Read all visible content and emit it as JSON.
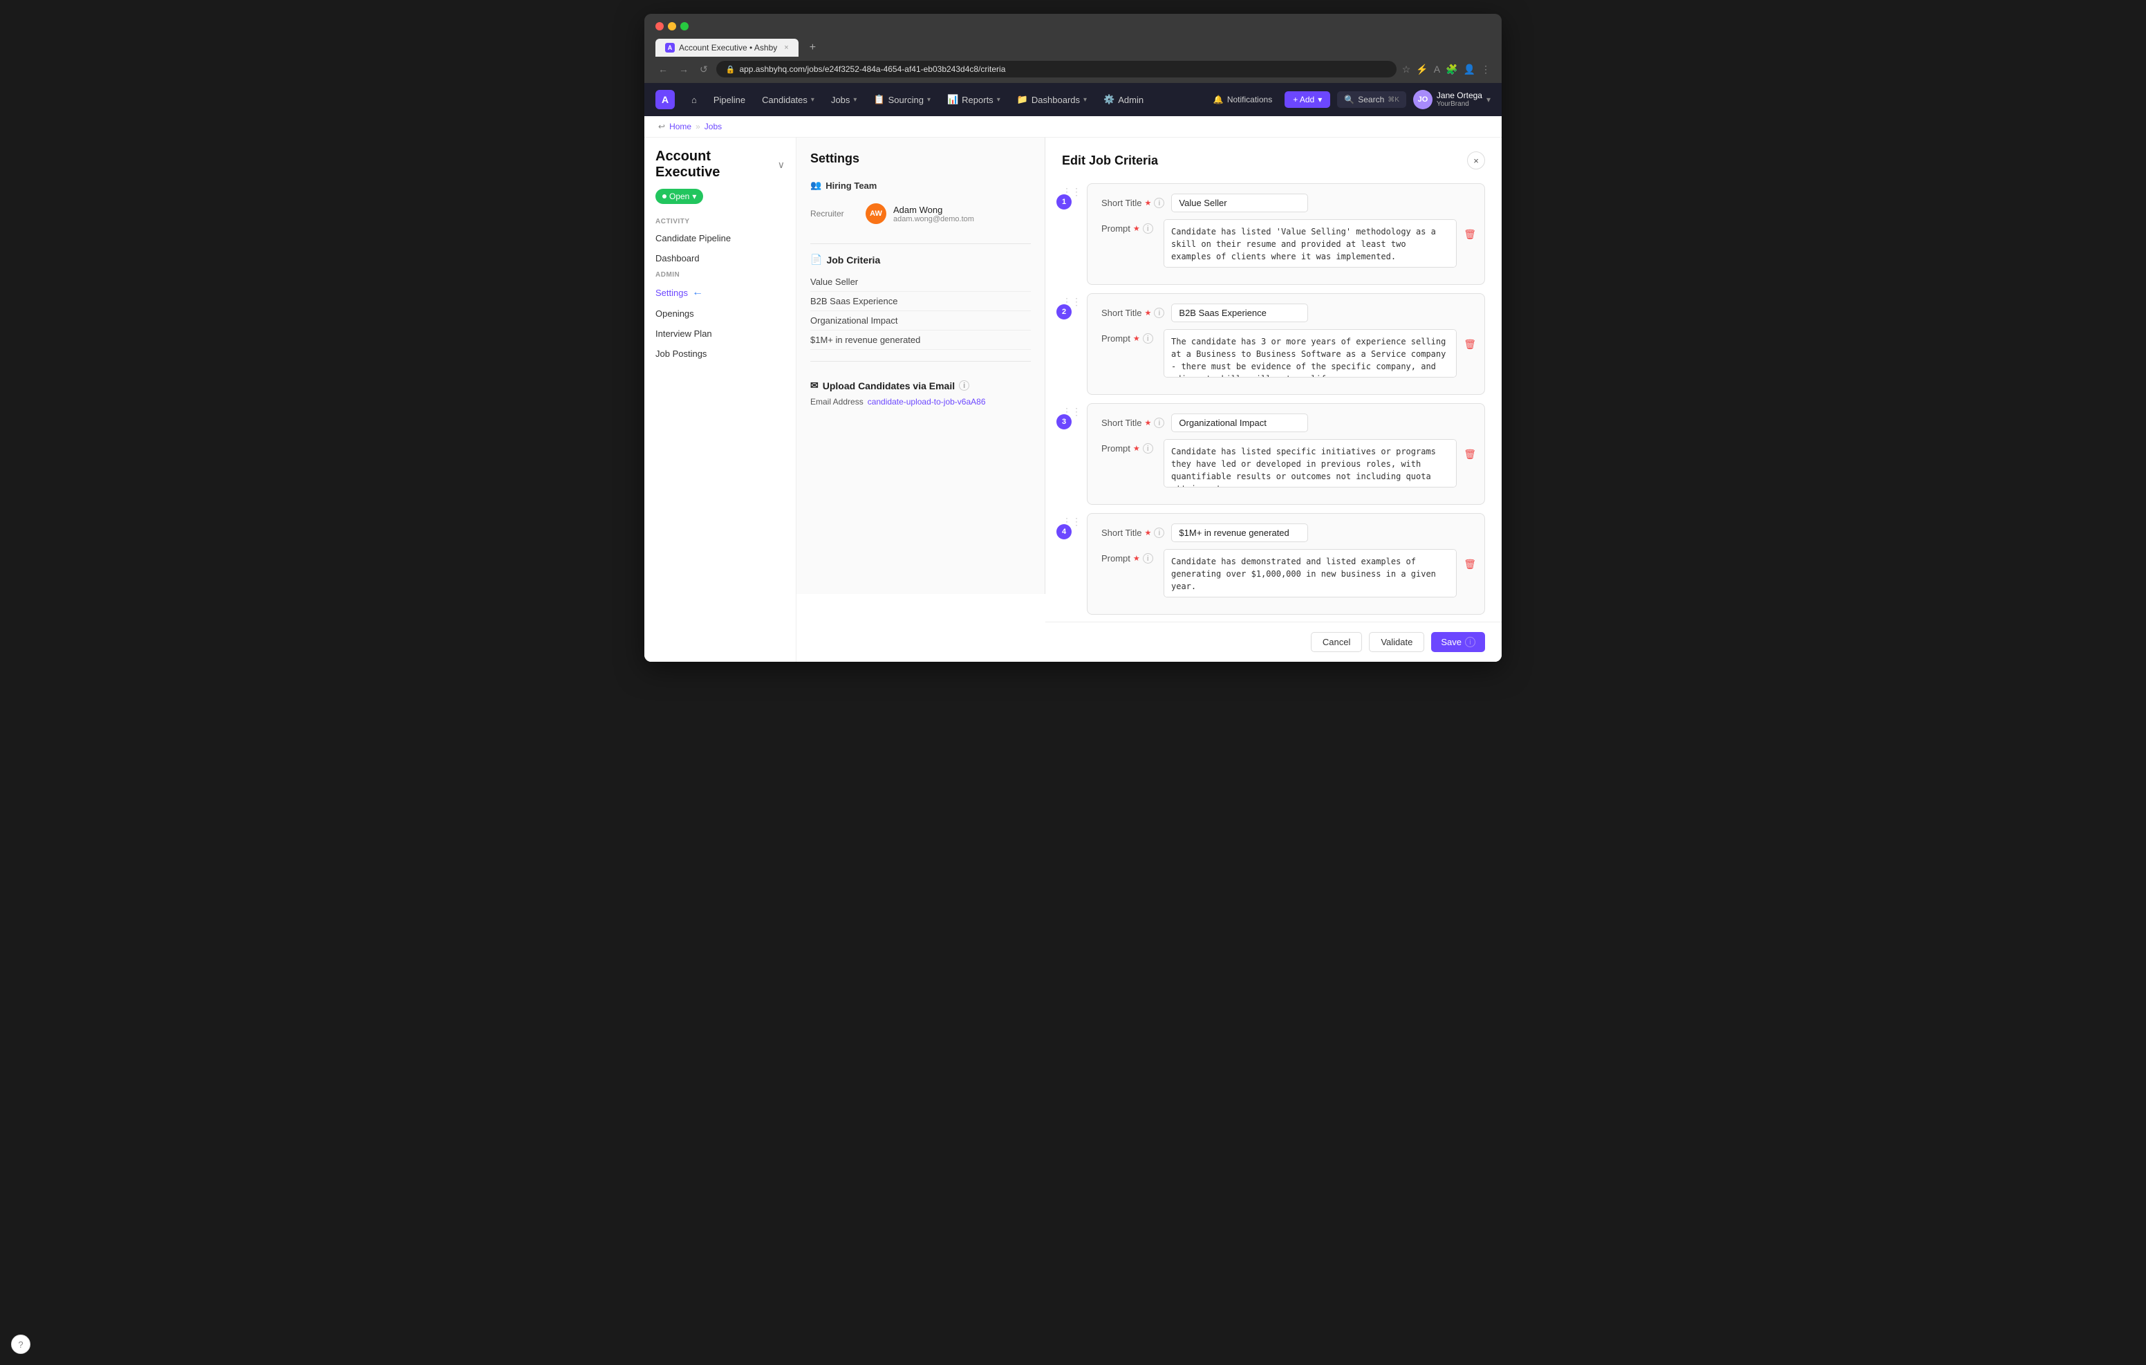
{
  "browser": {
    "tab_title": "Account Executive • Ashby",
    "url": "app.ashbyhq.com/jobs/e24f3252-484a-4654-af41-eb03b243d4c8/criteria",
    "nav_back": "←",
    "nav_forward": "→",
    "nav_reload": "↺"
  },
  "app_nav": {
    "logo": "A",
    "home_icon": "⌂",
    "items": [
      {
        "label": "Pipeline",
        "has_caret": false
      },
      {
        "label": "Candidates",
        "has_caret": true
      },
      {
        "label": "Jobs",
        "has_caret": true
      },
      {
        "label": "Sourcing",
        "has_caret": true
      },
      {
        "label": "Reports",
        "has_caret": true
      },
      {
        "label": "Dashboards",
        "has_caret": true
      },
      {
        "label": "Admin",
        "has_caret": false
      }
    ],
    "notifications_label": "Notifications",
    "add_label": "+ Add",
    "search_label": "Search",
    "search_shortcut": "⌘K",
    "user_name": "Jane Ortega",
    "user_brand": "YourBrand"
  },
  "breadcrumb": {
    "home": "Home",
    "separator": "»",
    "jobs": "Jobs"
  },
  "job": {
    "title": "Account Executive",
    "status": "Open",
    "status_caret": "▾"
  },
  "sidebar": {
    "activity_label": "ACTIVITY",
    "items_activity": [
      {
        "label": "Candidate Pipeline"
      },
      {
        "label": "Dashboard"
      }
    ],
    "admin_label": "ADMIN",
    "items_admin": [
      {
        "label": "Settings",
        "active": true
      },
      {
        "label": "Openings"
      },
      {
        "label": "Interview Plan"
      },
      {
        "label": "Job Postings"
      }
    ]
  },
  "settings_panel": {
    "title": "Settings",
    "hiring_team_section": "Hiring Team",
    "recruiter_label": "Recruiter",
    "recruiter_name": "Adam Wong",
    "recruiter_email": "adam.wong@demo.tom",
    "job_criteria_section": "Job Criteria",
    "criteria_items": [
      "Value Seller",
      "B2B Saas Experience",
      "Organizational Impact",
      "$1M+ in revenue generated"
    ],
    "upload_section": "Upload Candidates via Email",
    "upload_section_icon": "✉",
    "email_label": "Email Address",
    "email_value": "candidate-upload-to-job-v6aA86"
  },
  "edit_panel": {
    "title": "Edit Job Criteria",
    "close_label": "×",
    "cards": [
      {
        "number": "1",
        "short_title_label": "Short Title",
        "short_title_value": "Value Seller",
        "prompt_label": "Prompt",
        "prompt_value": "Candidate has listed 'Value Selling' methodology as a skill on their resume and provided at least two examples of clients where it was implemented."
      },
      {
        "number": "2",
        "short_title_label": "Short Title",
        "short_title_value": "B2B Saas Experience",
        "prompt_label": "Prompt",
        "prompt_value": "The candidate has 3 or more years of experience selling at a Business to Business Software as a Service company - there must be evidence of the specific company, and adjacent skills will not qualify."
      },
      {
        "number": "3",
        "short_title_label": "Short Title",
        "short_title_value": "Organizational Impact",
        "prompt_label": "Prompt",
        "prompt_value": "Candidate has listed specific initiatives or programs they have led or developed in previous roles, with quantifiable results or outcomes not including quota attainment."
      },
      {
        "number": "4",
        "short_title_label": "Short Title",
        "short_title_value": "$1M+ in revenue generated",
        "prompt_label": "Prompt",
        "prompt_value": "Candidate has demonstrated and listed examples of generating over $1,000,000 in new business in a given year."
      }
    ],
    "footer": {
      "cancel_label": "Cancel",
      "validate_label": "Validate",
      "save_label": "Save"
    }
  }
}
